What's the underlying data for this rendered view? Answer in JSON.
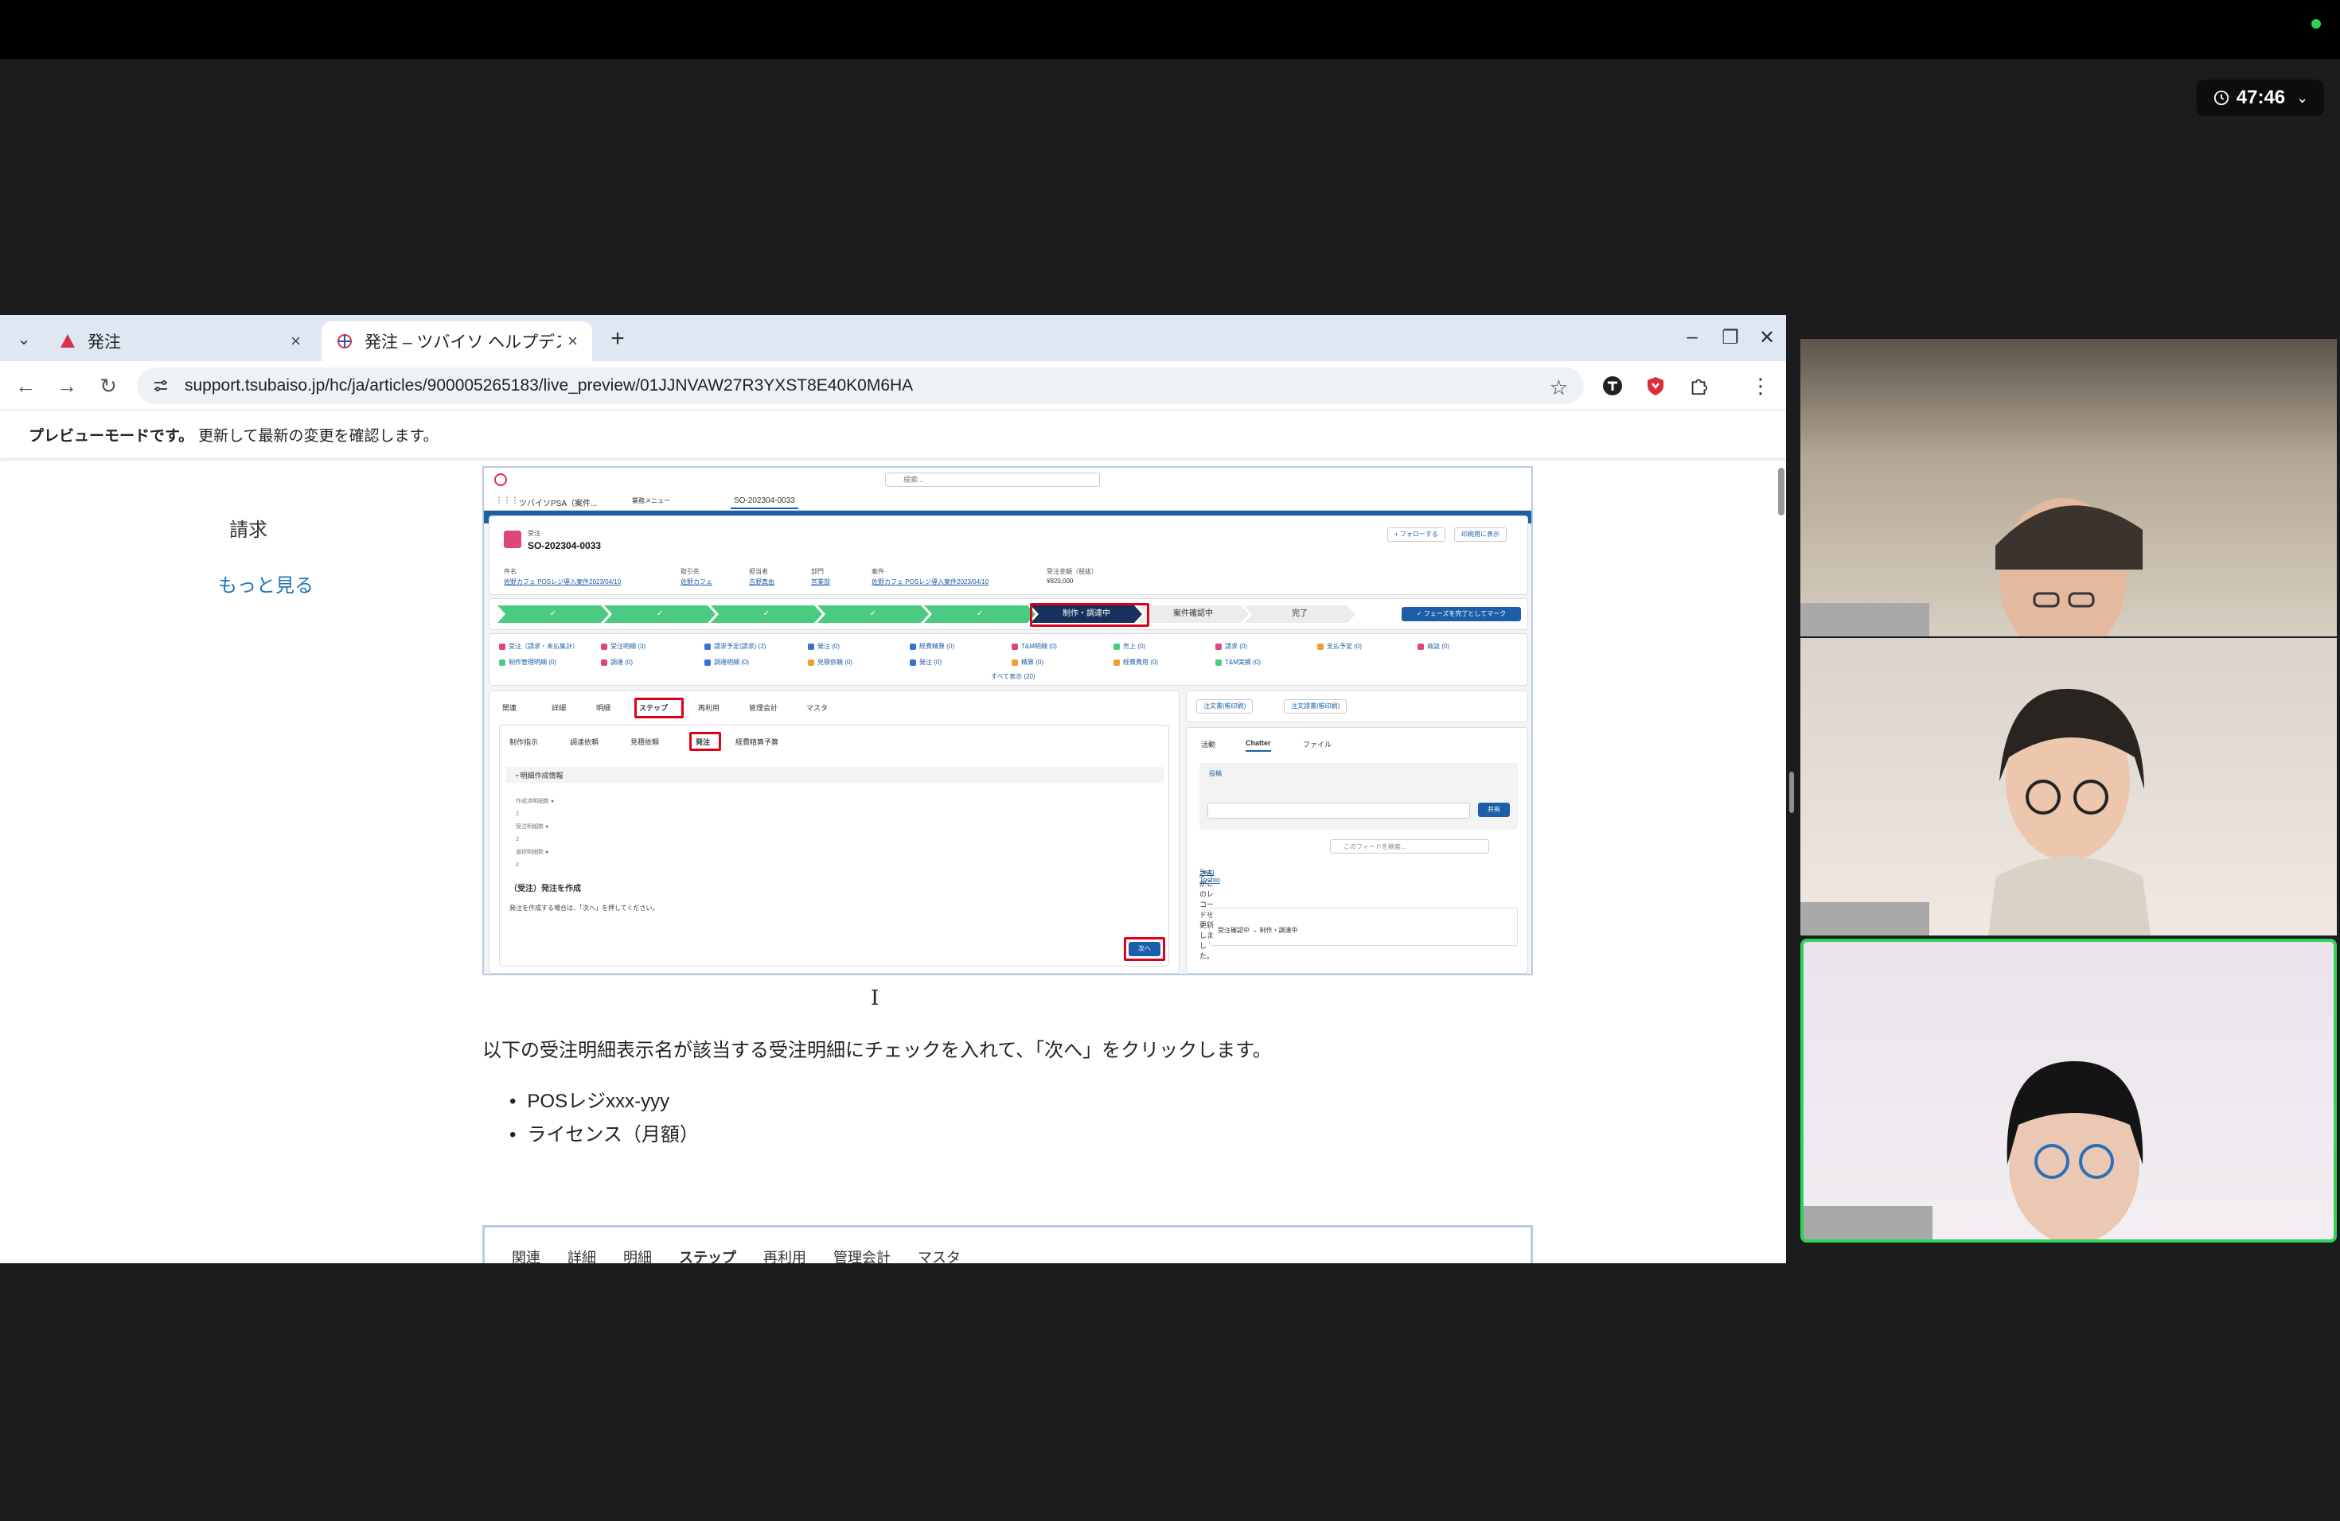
{
  "meeting": {
    "timer": "47:46"
  },
  "browser": {
    "tabs": [
      {
        "title": "発注",
        "active": false
      },
      {
        "title": "発注 – ツバイソ ヘルプデス",
        "active": true
      }
    ],
    "url": "support.tsubaiso.jp/hc/ja/articles/900005265183/live_preview/01JJNVAW27R3YXST8E40K0M6HA",
    "preview_bar": {
      "bold": "プレビューモードです。",
      "text": "更新して最新の変更を確認します。"
    }
  },
  "page": {
    "sidebar": {
      "item": "請求",
      "more": "もっと見る"
    },
    "screenshot": {
      "search_placeholder": "検索...",
      "app_name": "ツバイソPSA（案件...",
      "menu": "業務メニュー",
      "record_tab": "SO-202304-0033",
      "record_type": "受注",
      "record_id": "SO-202304-0033",
      "follow_button": "+ フォローする",
      "print_button": "印刷用に表示",
      "fields": [
        {
          "label": "件名",
          "value": "佐野カフェ POSレジ導入案件2023/04/10"
        },
        {
          "label": "取引先",
          "value": "佐野カフェ"
        },
        {
          "label": "担当者",
          "value": "吉野真由"
        },
        {
          "label": "部門",
          "value": "営業部"
        },
        {
          "label": "案件",
          "value": "佐野カフェ POSレジ導入案件2023/04/10"
        },
        {
          "label": "受注金額（税抜）",
          "value": "¥820,000"
        }
      ],
      "current_stage": "制作・調達中",
      "next_stages": [
        "案件確認中",
        "完了"
      ],
      "complete_button": "✓ フェーズを完了としてマーク",
      "show_all": "すべて表示 (20)",
      "tabs": [
        "関連",
        "詳細",
        "明細",
        "ステップ",
        "再利用",
        "管理会計",
        "マスタ"
      ],
      "subtabs": [
        "制作指示",
        "調達依頼",
        "見積依頼",
        "発注",
        "経費精算予算"
      ],
      "section_title": "明細作成情報",
      "action_title": "（受注）発注を作成",
      "action_desc": "発注を作成する場合は、「次へ」を押してください。",
      "next_button": "次へ",
      "right_buttons": [
        "注文書(帳印刷)",
        "注文請書(帳印刷)"
      ],
      "feed_tabs": [
        "活動",
        "Chatter",
        "ファイル"
      ],
      "post_label": "投稿",
      "share_button": "共有",
      "feed_search": "このフィードを検索...",
      "feed_user": "Sato Toshio",
      "feed_text": "さんがこのレコードを更新しました。",
      "feed_detail": "受注確認中 → 制作・調達中"
    },
    "instruction": "以下の受注明細表示名が該当する受注明細にチェックを入れて、「次へ」をクリックします。",
    "bullets": [
      "POSレジxxx-yyy",
      "ライセンス（月額）"
    ],
    "screenshot2_tabs": [
      "関連",
      "詳細",
      "明細",
      "ステップ",
      "再利用",
      "管理会計",
      "マスタ"
    ],
    "screenshot2_selected": "ステップ"
  },
  "colors": {
    "active_speaker": "#30d158",
    "link": "#1f73b7",
    "highlight": "#e0001b",
    "path_complete": "#4bca81",
    "path_current": "#16325c"
  }
}
